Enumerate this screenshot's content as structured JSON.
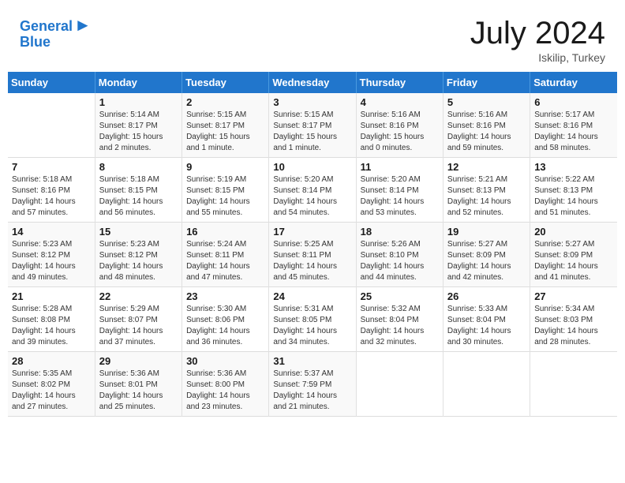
{
  "header": {
    "logo_line1": "General",
    "logo_line2": "Blue",
    "month_title": "July 2024",
    "location": "Iskilip, Turkey"
  },
  "weekdays": [
    "Sunday",
    "Monday",
    "Tuesday",
    "Wednesday",
    "Thursday",
    "Friday",
    "Saturday"
  ],
  "weeks": [
    [
      {
        "day": "",
        "info": ""
      },
      {
        "day": "1",
        "info": "Sunrise: 5:14 AM\nSunset: 8:17 PM\nDaylight: 15 hours\nand 2 minutes."
      },
      {
        "day": "2",
        "info": "Sunrise: 5:15 AM\nSunset: 8:17 PM\nDaylight: 15 hours\nand 1 minute."
      },
      {
        "day": "3",
        "info": "Sunrise: 5:15 AM\nSunset: 8:17 PM\nDaylight: 15 hours\nand 1 minute."
      },
      {
        "day": "4",
        "info": "Sunrise: 5:16 AM\nSunset: 8:16 PM\nDaylight: 15 hours\nand 0 minutes."
      },
      {
        "day": "5",
        "info": "Sunrise: 5:16 AM\nSunset: 8:16 PM\nDaylight: 14 hours\nand 59 minutes."
      },
      {
        "day": "6",
        "info": "Sunrise: 5:17 AM\nSunset: 8:16 PM\nDaylight: 14 hours\nand 58 minutes."
      }
    ],
    [
      {
        "day": "7",
        "info": "Sunrise: 5:18 AM\nSunset: 8:16 PM\nDaylight: 14 hours\nand 57 minutes."
      },
      {
        "day": "8",
        "info": "Sunrise: 5:18 AM\nSunset: 8:15 PM\nDaylight: 14 hours\nand 56 minutes."
      },
      {
        "day": "9",
        "info": "Sunrise: 5:19 AM\nSunset: 8:15 PM\nDaylight: 14 hours\nand 55 minutes."
      },
      {
        "day": "10",
        "info": "Sunrise: 5:20 AM\nSunset: 8:14 PM\nDaylight: 14 hours\nand 54 minutes."
      },
      {
        "day": "11",
        "info": "Sunrise: 5:20 AM\nSunset: 8:14 PM\nDaylight: 14 hours\nand 53 minutes."
      },
      {
        "day": "12",
        "info": "Sunrise: 5:21 AM\nSunset: 8:13 PM\nDaylight: 14 hours\nand 52 minutes."
      },
      {
        "day": "13",
        "info": "Sunrise: 5:22 AM\nSunset: 8:13 PM\nDaylight: 14 hours\nand 51 minutes."
      }
    ],
    [
      {
        "day": "14",
        "info": "Sunrise: 5:23 AM\nSunset: 8:12 PM\nDaylight: 14 hours\nand 49 minutes."
      },
      {
        "day": "15",
        "info": "Sunrise: 5:23 AM\nSunset: 8:12 PM\nDaylight: 14 hours\nand 48 minutes."
      },
      {
        "day": "16",
        "info": "Sunrise: 5:24 AM\nSunset: 8:11 PM\nDaylight: 14 hours\nand 47 minutes."
      },
      {
        "day": "17",
        "info": "Sunrise: 5:25 AM\nSunset: 8:11 PM\nDaylight: 14 hours\nand 45 minutes."
      },
      {
        "day": "18",
        "info": "Sunrise: 5:26 AM\nSunset: 8:10 PM\nDaylight: 14 hours\nand 44 minutes."
      },
      {
        "day": "19",
        "info": "Sunrise: 5:27 AM\nSunset: 8:09 PM\nDaylight: 14 hours\nand 42 minutes."
      },
      {
        "day": "20",
        "info": "Sunrise: 5:27 AM\nSunset: 8:09 PM\nDaylight: 14 hours\nand 41 minutes."
      }
    ],
    [
      {
        "day": "21",
        "info": "Sunrise: 5:28 AM\nSunset: 8:08 PM\nDaylight: 14 hours\nand 39 minutes."
      },
      {
        "day": "22",
        "info": "Sunrise: 5:29 AM\nSunset: 8:07 PM\nDaylight: 14 hours\nand 37 minutes."
      },
      {
        "day": "23",
        "info": "Sunrise: 5:30 AM\nSunset: 8:06 PM\nDaylight: 14 hours\nand 36 minutes."
      },
      {
        "day": "24",
        "info": "Sunrise: 5:31 AM\nSunset: 8:05 PM\nDaylight: 14 hours\nand 34 minutes."
      },
      {
        "day": "25",
        "info": "Sunrise: 5:32 AM\nSunset: 8:04 PM\nDaylight: 14 hours\nand 32 minutes."
      },
      {
        "day": "26",
        "info": "Sunrise: 5:33 AM\nSunset: 8:04 PM\nDaylight: 14 hours\nand 30 minutes."
      },
      {
        "day": "27",
        "info": "Sunrise: 5:34 AM\nSunset: 8:03 PM\nDaylight: 14 hours\nand 28 minutes."
      }
    ],
    [
      {
        "day": "28",
        "info": "Sunrise: 5:35 AM\nSunset: 8:02 PM\nDaylight: 14 hours\nand 27 minutes."
      },
      {
        "day": "29",
        "info": "Sunrise: 5:36 AM\nSunset: 8:01 PM\nDaylight: 14 hours\nand 25 minutes."
      },
      {
        "day": "30",
        "info": "Sunrise: 5:36 AM\nSunset: 8:00 PM\nDaylight: 14 hours\nand 23 minutes."
      },
      {
        "day": "31",
        "info": "Sunrise: 5:37 AM\nSunset: 7:59 PM\nDaylight: 14 hours\nand 21 minutes."
      },
      {
        "day": "",
        "info": ""
      },
      {
        "day": "",
        "info": ""
      },
      {
        "day": "",
        "info": ""
      }
    ]
  ]
}
